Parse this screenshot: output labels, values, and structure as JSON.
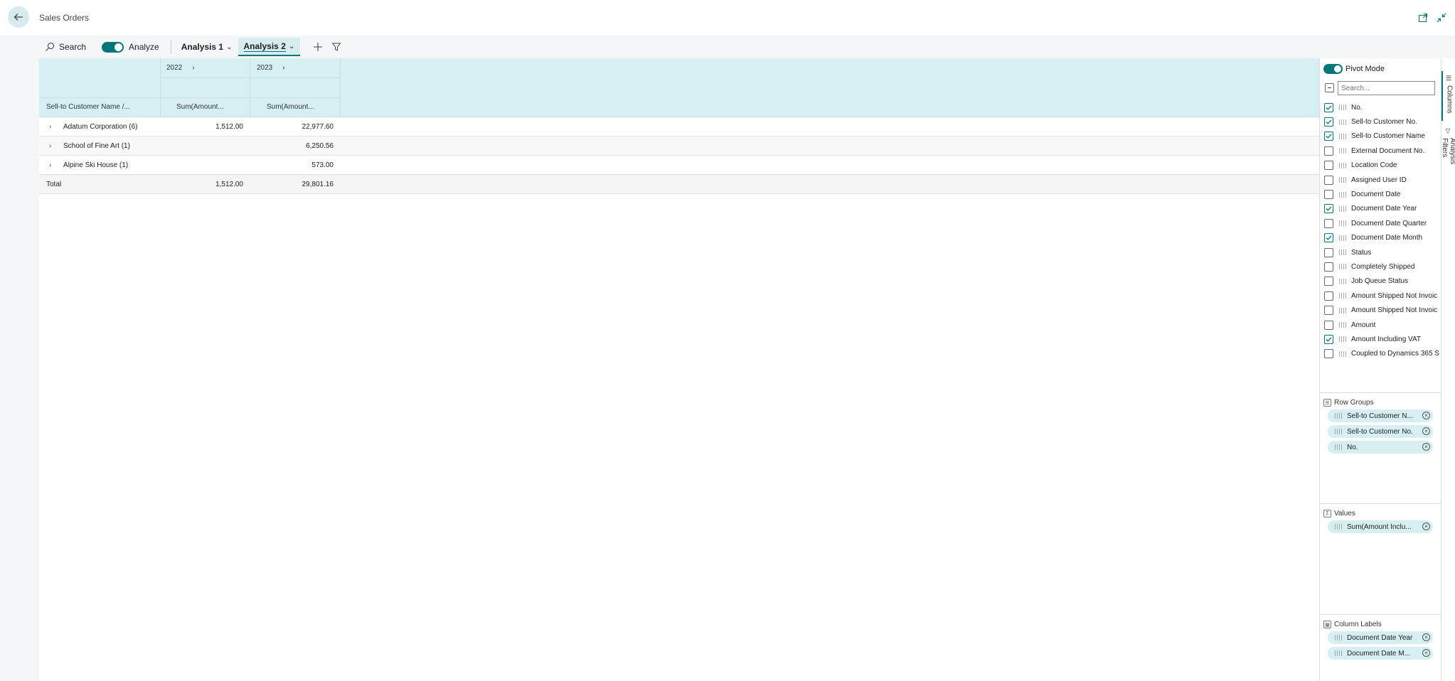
{
  "header": {
    "title": "Sales Orders"
  },
  "toolbar": {
    "search_label": "Search",
    "analyze_label": "Analyze",
    "tabs": [
      {
        "label": "Analysis 1"
      },
      {
        "label": "Analysis 2"
      }
    ]
  },
  "grid": {
    "years": [
      "2022",
      "2023"
    ],
    "row_group_header": "Sell-to Customer Name /...",
    "value_headers": [
      "Sum(Amount...",
      "Sum(Amount..."
    ],
    "rows": [
      {
        "label": "Adatum Corporation (6)",
        "v2022": "1,512.00",
        "v2023": "22,977.60"
      },
      {
        "label": "School of Fine Art (1)",
        "v2022": "",
        "v2023": "6,250.56"
      },
      {
        "label": "Alpine Ski House (1)",
        "v2022": "",
        "v2023": "573.00"
      }
    ],
    "total": {
      "label": "Total",
      "v2022": "1,512.00",
      "v2023": "29,801.16"
    }
  },
  "panel": {
    "pivot_mode_label": "Pivot Mode",
    "search_placeholder": "Search...",
    "columns": [
      {
        "name": "No.",
        "checked": true
      },
      {
        "name": "Sell-to Customer No.",
        "checked": true
      },
      {
        "name": "Sell-to Customer Name",
        "checked": true
      },
      {
        "name": "External Document No.",
        "checked": false
      },
      {
        "name": "Location Code",
        "checked": false
      },
      {
        "name": "Assigned User ID",
        "checked": false
      },
      {
        "name": "Document Date",
        "checked": false
      },
      {
        "name": "Document Date Year",
        "checked": true
      },
      {
        "name": "Document Date Quarter",
        "checked": false
      },
      {
        "name": "Document Date Month",
        "checked": true
      },
      {
        "name": "Status",
        "checked": false
      },
      {
        "name": "Completely Shipped",
        "checked": false
      },
      {
        "name": "Job Queue Status",
        "checked": false
      },
      {
        "name": "Amount Shipped Not Invoic",
        "checked": false
      },
      {
        "name": "Amount Shipped Not Invoic",
        "checked": false
      },
      {
        "name": "Amount",
        "checked": false
      },
      {
        "name": "Amount Including VAT",
        "checked": true
      },
      {
        "name": "Coupled to Dynamics 365 S",
        "checked": false
      }
    ],
    "row_groups": {
      "title": "Row Groups",
      "items": [
        "Sell-to Customer N...",
        "Sell-to Customer No.",
        "No."
      ]
    },
    "values": {
      "title": "Values",
      "items": [
        "Sum(Amount Inclu..."
      ]
    },
    "column_labels": {
      "title": "Column Labels",
      "items": [
        "Document Date Year",
        "Document Date M..."
      ]
    }
  },
  "side_tabs": {
    "columns_label": "Columns",
    "filters_label": "Analysis Filters"
  },
  "colors": {
    "accent": "#00757a",
    "header_bg": "#d6eff2",
    "pill_bg": "#d6eff2"
  }
}
